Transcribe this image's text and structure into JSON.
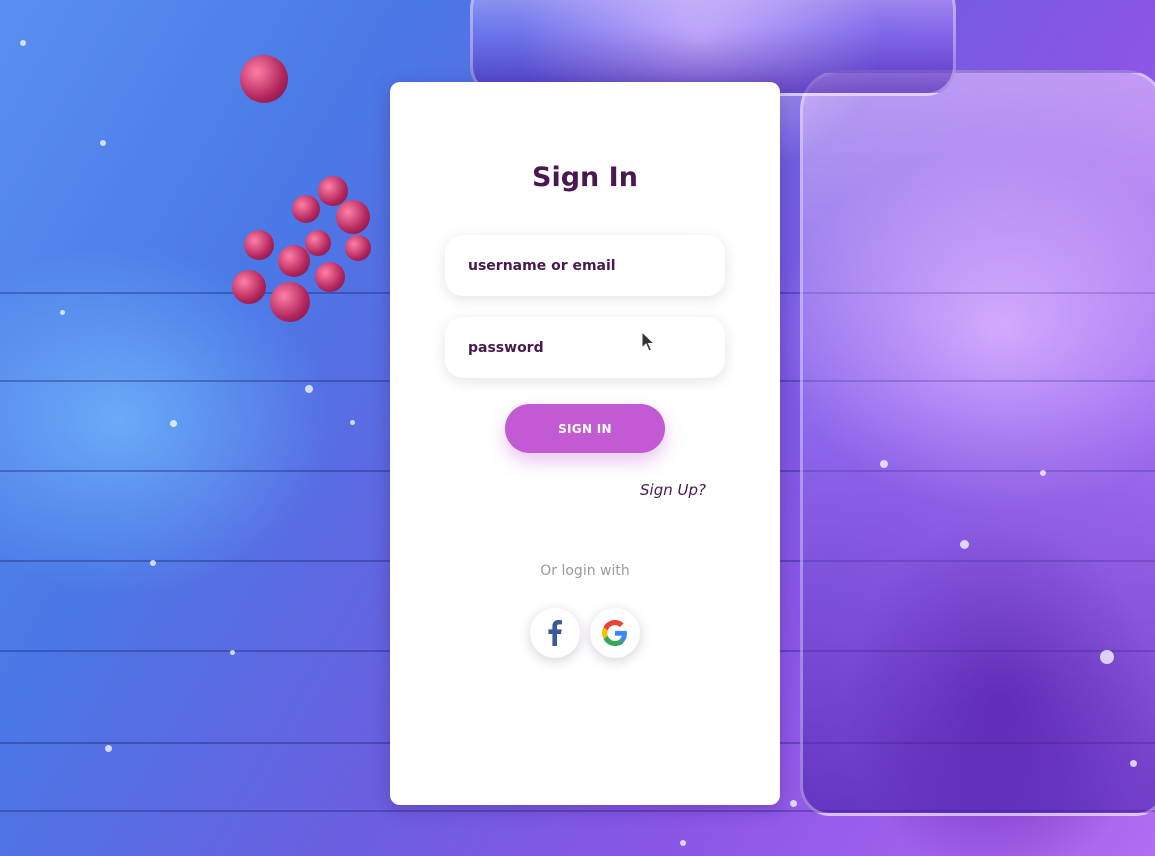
{
  "form": {
    "title": "Sign In",
    "username_placeholder": "username or email",
    "password_placeholder": "password",
    "signin_label": "SIGN IN",
    "signup_link": "Sign Up?",
    "alt_login_label": "Or login with"
  },
  "social": [
    {
      "name": "Facebook",
      "icon": "facebook-icon"
    },
    {
      "name": "Google",
      "icon": "google-icon"
    }
  ],
  "colors": {
    "title": "#4a1850",
    "accent_button": "#c25ad3",
    "muted_text": "#9a9a9a"
  }
}
